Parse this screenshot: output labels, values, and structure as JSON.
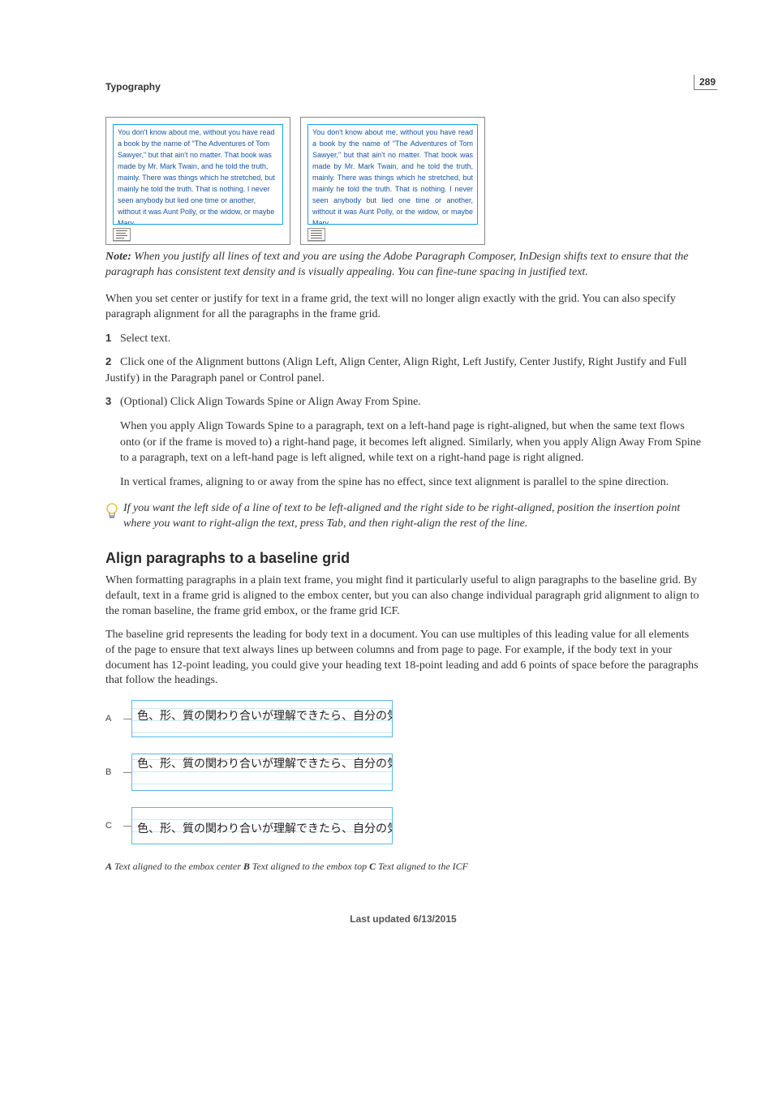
{
  "pageNumber": "289",
  "sectionLabel": "Typography",
  "sampleTextA": "You don't know about me, without you have read a book by the name of \"The Adventures of Tom Sawyer,\" but that ain't no matter. That book was made by Mr. Mark Twain, and he told the truth, mainly. There was things which he stretched, but mainly he told the truth. That is nothing. I never seen anybody but lied one time or another, without it was Aunt Polly, or the widow, or maybe Mary.",
  "sampleTextB": "You don't know about me, without you have read a book by the name of \"The Adventures of Tom Sawyer,\" but that ain't no matter. That book was made by Mr. Mark Twain, and he told the truth, mainly. There was things which he stretched, but mainly he told the truth. That is nothing. I never seen anybody but lied one time or another, without it was Aunt Polly, or the widow, or maybe Mary.",
  "note": {
    "label": "Note:",
    "text": " When you justify all lines of text and you are using the Adobe Paragraph Composer, InDesign shifts text to ensure that the paragraph has consistent text density and is visually appealing. You can fine-tune spacing in justified text."
  },
  "intro": "When you set center or justify for text in a frame grid, the text will no longer align exactly with the grid. You can also specify paragraph alignment for all the paragraphs in the frame grid.",
  "steps": {
    "1": "Select text.",
    "2": "Click one of the Alignment buttons (Align Left, Align Center, Align Right, Left Justify, Center Justify, Right Justify and Full Justify) in the Paragraph panel or Control panel.",
    "3": "(Optional) Click Align Towards Spine or Align Away From Spine.",
    "3sub1": "When you apply Align Towards Spine to a paragraph, text on a left-hand page is right-aligned, but when the same text flows onto (or if the frame is moved to) a right-hand page, it becomes left aligned. Similarly, when you apply Align Away From Spine to a paragraph, text on a left-hand page is left aligned, while text on a right-hand page is right aligned.",
    "3sub2": "In vertical frames, aligning to or away from the spine has no effect, since text alignment is parallel to the spine direction."
  },
  "tip": "If you want the left side of a line of text to be left-aligned and the right side to be right-aligned, position the insertion point where you want to right-align the text, press Tab, and then right-align the rest of the line.",
  "heading": "Align paragraphs to a baseline grid",
  "para1": "When formatting paragraphs in a plain text frame, you might find it particularly useful to align paragraphs to the baseline grid. By default, text in a frame grid is aligned to the embox center, but you can also change individual paragraph grid alignment to align to the roman baseline, the frame grid embox, or the frame grid ICF.",
  "para2": "The baseline grid represents the leading for body text in a document. You can use multiples of this leading value for all elements of the page to ensure that text always lines up between columns and from page to page. For example, if the body text in your document has 12-point leading, you could give your heading text 18-point leading and add 6 points of space before the paragraphs that follow the headings.",
  "jpText": "色、形、質の関わり合いが理解できたら、自分の気に入",
  "figLabels": {
    "A": "A",
    "B": "B",
    "C": "C"
  },
  "figCaption": {
    "A_label": "A",
    "A_text": " Text aligned to the embox center  ",
    "B_label": "B",
    "B_text": " Text aligned to the embox top  ",
    "C_label": "C",
    "C_text": " Text aligned to the ICF"
  },
  "footer": "Last updated 6/13/2015"
}
